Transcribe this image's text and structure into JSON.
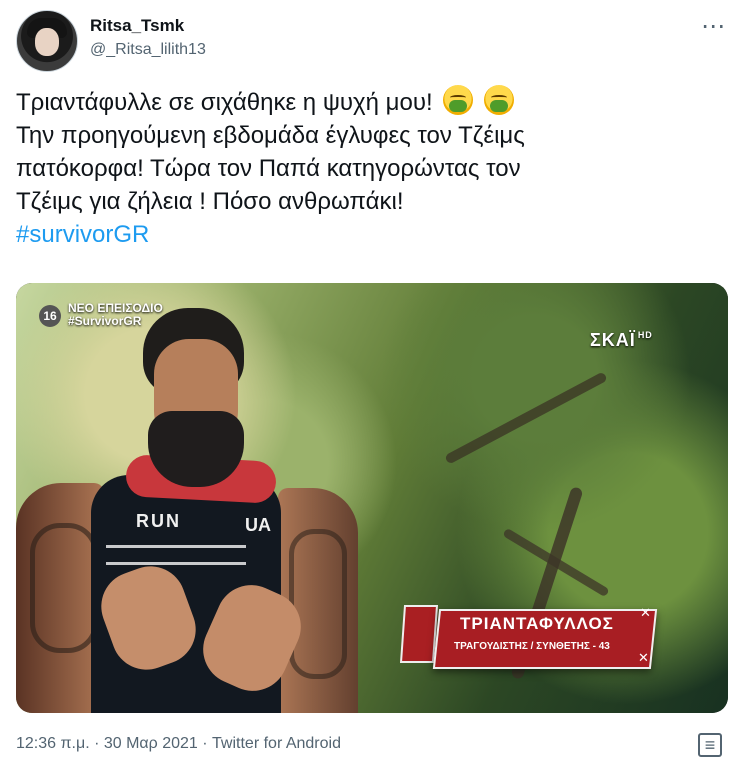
{
  "tweet": {
    "display_name": "Ritsa_Tsmk",
    "handle": "@_Ritsa_lilith13",
    "text_lines": [
      "Τριαντάφυλλε σε σιχάθηκε η ψυχή μου!",
      "Την προηγούμενη εβδομάδα έγλυφες τον Τζέιμς",
      "πατόκορφα! Τώρα τον Παπά κατηγορώντας τον",
      "Τζέιμς για ζήλεια ! Πόσο ανθρωπάκι!"
    ],
    "hashtag": "#survivorGR",
    "meta": "12:36 π.μ. · 30 Μαρ 2021 · Twitter for Android"
  },
  "media": {
    "channel_number": "16",
    "episode_label": "ΝΕΟ ΕΠΕΙΣΟΔΙΟ",
    "episode_hashtag": "#SurvivorGR",
    "channel_logo": "ΣΚΑΪ",
    "channel_logo_suffix": "HD",
    "shirt_text": "RUN",
    "shirt_logo": "UA",
    "contestant_name": "ΤΡΙΑΝΤΑΦΥΛΛΟΣ",
    "contestant_role": "ΤΡΑΓΟΥΔΙΣΤΗΣ / ΣΥΝΘΕΤΗΣ - 43"
  },
  "icons": {
    "more": "more-icon",
    "emoji": "sick-face-icon",
    "analytics": "analytics-icon"
  },
  "colors": {
    "link": "#1d9bf0",
    "secondary_text": "#536471",
    "contestant_plate": "#a81e23"
  }
}
